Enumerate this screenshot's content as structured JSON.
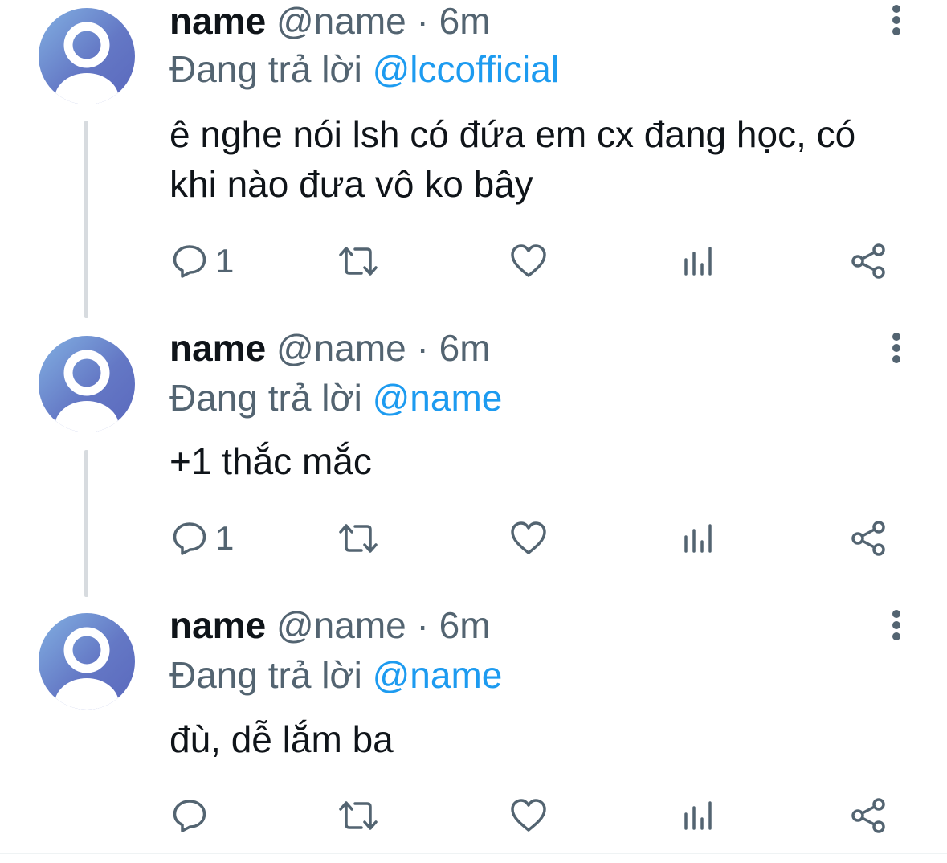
{
  "colors": {
    "text_primary": "#0f1419",
    "text_secondary": "#536471",
    "mention": "#1d9bf0",
    "thread_line": "#d7dbdf",
    "avatar_gradient": [
      "#82b0e2",
      "#5a68bd"
    ]
  },
  "icons": {
    "more": "more-vertical-icon",
    "reply": "reply-bubble-icon",
    "retweet": "retweet-icon",
    "like": "heart-icon",
    "views": "analytics-bars-icon",
    "share": "share-icon"
  },
  "tweets": [
    {
      "display_name": "name",
      "handle": "@name",
      "separator": "·",
      "time": "6m",
      "reply_prefix": "Đang trả lời",
      "reply_to": "@lccofficial",
      "text": "ê nghe nói lsh có đứa em cx đang học, có khi nào đưa vô ko bây",
      "reply_count": "1"
    },
    {
      "display_name": "name",
      "handle": "@name",
      "separator": "·",
      "time": "6m",
      "reply_prefix": "Đang trả lời",
      "reply_to": "@name",
      "text": "+1 thắc mắc",
      "reply_count": "1"
    },
    {
      "display_name": "name",
      "handle": "@name",
      "separator": "·",
      "time": "6m",
      "reply_prefix": "Đang trả lời",
      "reply_to": "@name",
      "text": "đù, dễ lắm ba",
      "reply_count": ""
    }
  ]
}
